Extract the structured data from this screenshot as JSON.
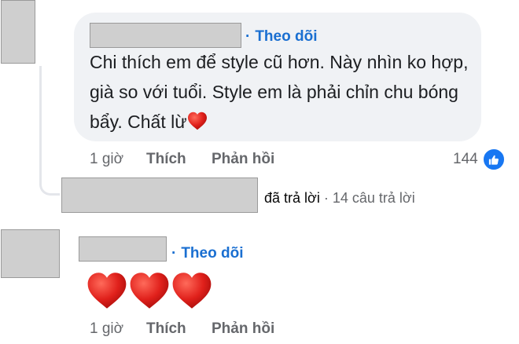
{
  "comment1": {
    "follow_label": "Theo dõi",
    "text": "Chi thích em để style cũ hơn. Này nhìn ko hợp, già so với tuổi. Style em là phải chỉn chu bóng bẩy. Chất lừ",
    "emoji": "red-heart-icon",
    "time": "1 giờ",
    "like_label": "Thích",
    "reply_label": "Phản hồi",
    "reaction_count": "144",
    "reaction_icon": "like-icon"
  },
  "reply_thread": {
    "replied_label": "đã trả lời",
    "separator": " · ",
    "reply_count": "14 câu trả lời"
  },
  "comment2": {
    "follow_label": "Theo dõi",
    "emojis": [
      "red-heart-icon",
      "red-heart-icon",
      "red-heart-icon"
    ],
    "time": "1 giờ",
    "like_label": "Thích",
    "reply_label": "Phản hồi"
  },
  "colors": {
    "bubble": "#f0f2f5",
    "link": "#1a6fd1",
    "meta": "#65676b",
    "like_badge": "#1877f2",
    "heart": "#e0201b",
    "redaction": "#cfcfcf"
  }
}
